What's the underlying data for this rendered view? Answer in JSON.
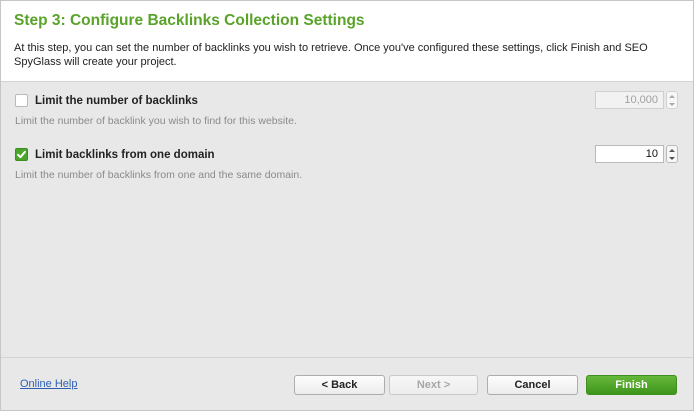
{
  "header": {
    "title": "Step 3: Configure Backlinks Collection Settings",
    "description": "At this step, you can set the number of backlinks you wish to retrieve. Once you've configured these settings, click Finish and SEO SpyGlass will create your project."
  },
  "options": [
    {
      "label": "Limit the number of backlinks",
      "hint": "Limit the number of backlink you wish to find for this website.",
      "checked": false,
      "value": "10,000",
      "enabled": false
    },
    {
      "label": "Limit backlinks from one domain",
      "hint": "Limit the number of backlinks from one and the same domain.",
      "checked": true,
      "value": "10",
      "enabled": true
    }
  ],
  "footer": {
    "help_link": "Online Help",
    "back": "< Back",
    "next": "Next >",
    "cancel": "Cancel",
    "finish": "Finish"
  },
  "colors": {
    "accent": "#5aa32a",
    "finish_button": "#4aa52b",
    "link": "#2f5fb3"
  },
  "icons": [
    "checkmark-icon",
    "spinner-up-arrow-icon",
    "spinner-down-arrow-icon"
  ]
}
